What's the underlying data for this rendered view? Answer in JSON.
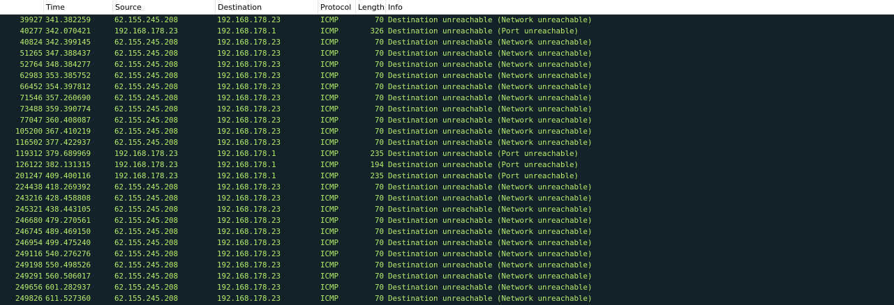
{
  "packet_list": {
    "columns": {
      "no": "",
      "time": "Time",
      "source": "Source",
      "destination": "Destination",
      "protocol": "Protocol",
      "length": "Length",
      "info": "Info"
    },
    "text_color": "#b4ec6a",
    "background_color": "#132229",
    "rows": [
      {
        "no": "39927",
        "time": "341.382259",
        "source": "62.155.245.208",
        "destination": "192.168.178.23",
        "protocol": "ICMP",
        "length": "70",
        "info": "Destination unreachable (Network unreachable)"
      },
      {
        "no": "40277",
        "time": "342.070421",
        "source": "192.168.178.23",
        "destination": "192.168.178.1",
        "protocol": "ICMP",
        "length": "326",
        "info": "Destination unreachable (Port unreachable)"
      },
      {
        "no": "40824",
        "time": "342.399145",
        "source": "62.155.245.208",
        "destination": "192.168.178.23",
        "protocol": "ICMP",
        "length": "70",
        "info": "Destination unreachable (Network unreachable)"
      },
      {
        "no": "51265",
        "time": "347.388437",
        "source": "62.155.245.208",
        "destination": "192.168.178.23",
        "protocol": "ICMP",
        "length": "70",
        "info": "Destination unreachable (Network unreachable)"
      },
      {
        "no": "52764",
        "time": "348.384277",
        "source": "62.155.245.208",
        "destination": "192.168.178.23",
        "protocol": "ICMP",
        "length": "70",
        "info": "Destination unreachable (Network unreachable)"
      },
      {
        "no": "62983",
        "time": "353.385752",
        "source": "62.155.245.208",
        "destination": "192.168.178.23",
        "protocol": "ICMP",
        "length": "70",
        "info": "Destination unreachable (Network unreachable)"
      },
      {
        "no": "66452",
        "time": "354.397812",
        "source": "62.155.245.208",
        "destination": "192.168.178.23",
        "protocol": "ICMP",
        "length": "70",
        "info": "Destination unreachable (Network unreachable)"
      },
      {
        "no": "71546",
        "time": "357.260690",
        "source": "62.155.245.208",
        "destination": "192.168.178.23",
        "protocol": "ICMP",
        "length": "70",
        "info": "Destination unreachable (Network unreachable)"
      },
      {
        "no": "73488",
        "time": "359.390774",
        "source": "62.155.245.208",
        "destination": "192.168.178.23",
        "protocol": "ICMP",
        "length": "70",
        "info": "Destination unreachable (Network unreachable)"
      },
      {
        "no": "77047",
        "time": "360.408087",
        "source": "62.155.245.208",
        "destination": "192.168.178.23",
        "protocol": "ICMP",
        "length": "70",
        "info": "Destination unreachable (Network unreachable)"
      },
      {
        "no": "105200",
        "time": "367.410219",
        "source": "62.155.245.208",
        "destination": "192.168.178.23",
        "protocol": "ICMP",
        "length": "70",
        "info": "Destination unreachable (Network unreachable)"
      },
      {
        "no": "116502",
        "time": "377.422937",
        "source": "62.155.245.208",
        "destination": "192.168.178.23",
        "protocol": "ICMP",
        "length": "70",
        "info": "Destination unreachable (Network unreachable)"
      },
      {
        "no": "119312",
        "time": "379.689969",
        "source": "192.168.178.23",
        "destination": "192.168.178.1",
        "protocol": "ICMP",
        "length": "235",
        "info": "Destination unreachable (Port unreachable)"
      },
      {
        "no": "126122",
        "time": "382.131315",
        "source": "192.168.178.23",
        "destination": "192.168.178.1",
        "protocol": "ICMP",
        "length": "194",
        "info": "Destination unreachable (Port unreachable)"
      },
      {
        "no": "201247",
        "time": "409.400116",
        "source": "192.168.178.23",
        "destination": "192.168.178.1",
        "protocol": "ICMP",
        "length": "235",
        "info": "Destination unreachable (Port unreachable)"
      },
      {
        "no": "224438",
        "time": "418.269392",
        "source": "62.155.245.208",
        "destination": "192.168.178.23",
        "protocol": "ICMP",
        "length": "70",
        "info": "Destination unreachable (Network unreachable)"
      },
      {
        "no": "243216",
        "time": "428.458808",
        "source": "62.155.245.208",
        "destination": "192.168.178.23",
        "protocol": "ICMP",
        "length": "70",
        "info": "Destination unreachable (Network unreachable)"
      },
      {
        "no": "245321",
        "time": "438.443105",
        "source": "62.155.245.208",
        "destination": "192.168.178.23",
        "protocol": "ICMP",
        "length": "70",
        "info": "Destination unreachable (Network unreachable)"
      },
      {
        "no": "246680",
        "time": "479.270561",
        "source": "62.155.245.208",
        "destination": "192.168.178.23",
        "protocol": "ICMP",
        "length": "70",
        "info": "Destination unreachable (Network unreachable)"
      },
      {
        "no": "246745",
        "time": "489.469150",
        "source": "62.155.245.208",
        "destination": "192.168.178.23",
        "protocol": "ICMP",
        "length": "70",
        "info": "Destination unreachable (Network unreachable)"
      },
      {
        "no": "246954",
        "time": "499.475240",
        "source": "62.155.245.208",
        "destination": "192.168.178.23",
        "protocol": "ICMP",
        "length": "70",
        "info": "Destination unreachable (Network unreachable)"
      },
      {
        "no": "249116",
        "time": "540.276276",
        "source": "62.155.245.208",
        "destination": "192.168.178.23",
        "protocol": "ICMP",
        "length": "70",
        "info": "Destination unreachable (Network unreachable)"
      },
      {
        "no": "249198",
        "time": "550.498526",
        "source": "62.155.245.208",
        "destination": "192.168.178.23",
        "protocol": "ICMP",
        "length": "70",
        "info": "Destination unreachable (Network unreachable)"
      },
      {
        "no": "249291",
        "time": "560.506017",
        "source": "62.155.245.208",
        "destination": "192.168.178.23",
        "protocol": "ICMP",
        "length": "70",
        "info": "Destination unreachable (Network unreachable)"
      },
      {
        "no": "249656",
        "time": "601.282937",
        "source": "62.155.245.208",
        "destination": "192.168.178.23",
        "protocol": "ICMP",
        "length": "70",
        "info": "Destination unreachable (Network unreachable)"
      },
      {
        "no": "249826",
        "time": "611.527360",
        "source": "62.155.245.208",
        "destination": "192.168.178.23",
        "protocol": "ICMP",
        "length": "70",
        "info": "Destination unreachable (Network unreachable)"
      }
    ]
  }
}
